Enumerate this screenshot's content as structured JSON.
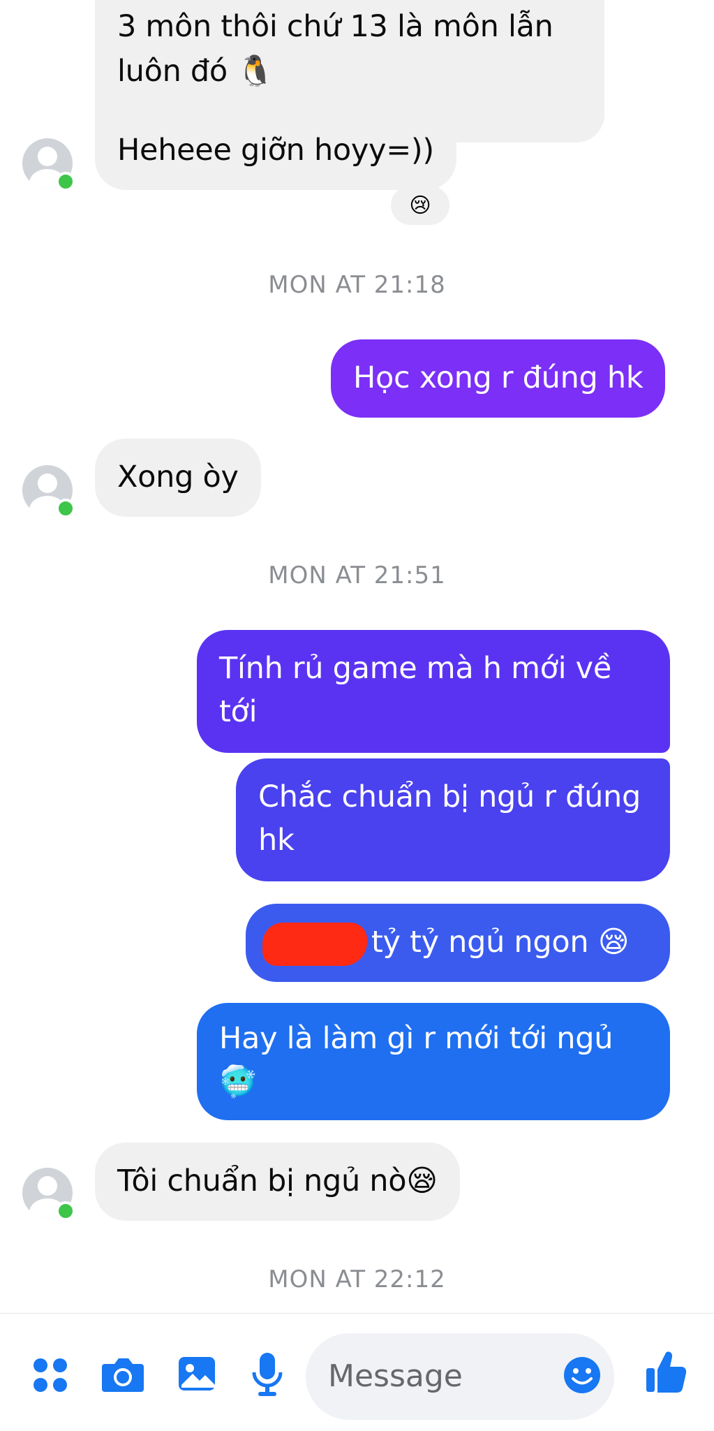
{
  "messages": [
    {
      "dir": "in",
      "lines": [
        "3 môn thôi chứ 13 là môn lẫn",
        "luôn đó 🐧"
      ]
    },
    {
      "dir": "in",
      "lines": [
        "Heheee giỡn hoyy=))"
      ],
      "reaction": "😢"
    },
    {
      "timestamp": "MON AT 21:18"
    },
    {
      "dir": "out",
      "lines": [
        "Học xong r đúng hk"
      ]
    },
    {
      "dir": "in",
      "lines": [
        "Xong òy"
      ]
    },
    {
      "timestamp": "MON AT 21:51"
    },
    {
      "dir": "out",
      "lines": [
        "Tính rủ game mà h mới về",
        "tới"
      ]
    },
    {
      "dir": "out",
      "lines": [
        "Chắc chuẩn bị ngủ r đúng",
        "hk"
      ]
    },
    {
      "dir": "out",
      "lines": [
        "tỷ tỷ ngủ ngon 😪"
      ],
      "redacted": true
    },
    {
      "dir": "out",
      "lines": [
        "Hay là làm gì r mới tới ngủ",
        "🥶"
      ]
    },
    {
      "dir": "in",
      "lines": [
        "Tôi chuẩn bị ngủ nò😪"
      ]
    },
    {
      "timestamp": "MON AT 22:12"
    }
  ],
  "composer": {
    "placeholder": "Message",
    "icons": [
      "apps-icon",
      "camera-icon",
      "gallery-icon",
      "microphone-icon",
      "emoji-icon",
      "like-icon"
    ]
  },
  "colors": {
    "out_1": "#7b2ff7",
    "out_2": "#5a33f2",
    "out_3": "#4a41ef",
    "out_4": "#3b5bef",
    "out_5": "#1f6ff0",
    "accent": "#1877f2",
    "online": "#3ec54a",
    "incoming_bg": "#f0f0f0"
  }
}
